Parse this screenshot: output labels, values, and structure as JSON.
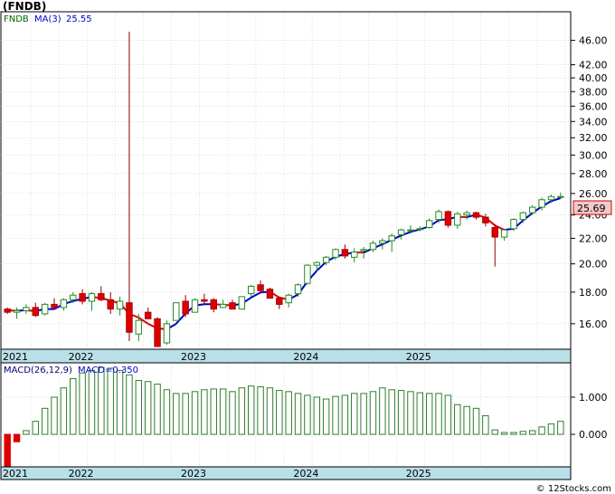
{
  "title": "(FNDB)",
  "footer": "© 12Stocks.com",
  "chart_data": [
    {
      "type": "candlestick",
      "name": "price",
      "legend": {
        "symbol": "FNDB",
        "ma_label": "MA(3)",
        "ma_value": "25.55"
      },
      "last_price_label": "25.69",
      "y_scale": "log",
      "ylim": [
        14.6,
        51
      ],
      "y_ticks": [
        "16.00",
        "18.00",
        "20.00",
        "22.00",
        "24.00",
        "26.00",
        "28.00",
        "30.00",
        "32.00",
        "34.00",
        "36.00",
        "38.00",
        "40.00",
        "42.00",
        "46.00"
      ],
      "x_labels": [
        "2021",
        "2022",
        "2023",
        "2024",
        "2025"
      ],
      "candles": [
        [
          16.9,
          17.0,
          16.6,
          16.7
        ],
        [
          16.7,
          17.0,
          16.3,
          16.8
        ],
        [
          16.8,
          17.2,
          16.6,
          17.0
        ],
        [
          17.0,
          17.3,
          16.4,
          16.5
        ],
        [
          16.6,
          17.3,
          16.5,
          17.2
        ],
        [
          17.2,
          17.6,
          16.9,
          17.0
        ],
        [
          17.0,
          17.6,
          16.8,
          17.5
        ],
        [
          17.5,
          18.0,
          17.3,
          17.8
        ],
        [
          17.9,
          18.2,
          17.2,
          17.4
        ],
        [
          17.4,
          18.0,
          16.8,
          17.9
        ],
        [
          17.9,
          18.4,
          17.4,
          17.5
        ],
        [
          17.5,
          18.0,
          16.6,
          16.9
        ],
        [
          16.9,
          17.7,
          16.5,
          17.4
        ],
        [
          17.3,
          47.5,
          15.0,
          15.5
        ],
        [
          15.4,
          16.6,
          15.0,
          16.2
        ],
        [
          16.7,
          17.0,
          16.3,
          16.3
        ],
        [
          16.3,
          16.4,
          14.7,
          14.7
        ],
        [
          14.9,
          16.2,
          14.8,
          16.0
        ],
        [
          16.2,
          17.3,
          16.2,
          17.3
        ],
        [
          17.4,
          17.8,
          16.4,
          16.6
        ],
        [
          16.7,
          17.6,
          16.7,
          17.5
        ],
        [
          17.5,
          17.9,
          17.2,
          17.4
        ],
        [
          17.5,
          17.6,
          16.7,
          16.9
        ],
        [
          17.0,
          17.5,
          17.0,
          17.2
        ],
        [
          17.3,
          17.5,
          16.9,
          16.9
        ],
        [
          16.9,
          17.7,
          16.9,
          17.7
        ],
        [
          17.9,
          18.5,
          17.7,
          18.4
        ],
        [
          18.5,
          18.8,
          17.9,
          18.1
        ],
        [
          18.2,
          18.3,
          17.6,
          17.6
        ],
        [
          17.6,
          17.7,
          16.9,
          17.2
        ],
        [
          17.3,
          17.9,
          17.0,
          17.8
        ],
        [
          17.9,
          18.6,
          17.7,
          18.5
        ],
        [
          18.6,
          20.0,
          18.5,
          19.9
        ],
        [
          19.9,
          20.2,
          19.4,
          20.1
        ],
        [
          20.1,
          20.6,
          19.9,
          20.5
        ],
        [
          20.5,
          21.2,
          20.3,
          21.1
        ],
        [
          21.1,
          21.5,
          20.4,
          20.6
        ],
        [
          20.5,
          21.2,
          20.1,
          20.9
        ],
        [
          21.0,
          21.3,
          20.4,
          21.1
        ],
        [
          21.1,
          21.8,
          20.9,
          21.6
        ],
        [
          21.6,
          22.0,
          21.1,
          21.8
        ],
        [
          21.8,
          22.4,
          20.9,
          22.2
        ],
        [
          22.3,
          22.8,
          21.9,
          22.7
        ],
        [
          22.7,
          23.1,
          22.4,
          22.7
        ],
        [
          22.8,
          23.0,
          22.6,
          22.8
        ],
        [
          22.9,
          23.7,
          22.8,
          23.5
        ],
        [
          23.6,
          24.5,
          23.3,
          24.3
        ],
        [
          24.3,
          24.4,
          22.9,
          23.1
        ],
        [
          23.1,
          24.3,
          22.8,
          24.1
        ],
        [
          24.0,
          24.4,
          23.6,
          24.2
        ],
        [
          24.2,
          24.3,
          23.6,
          23.8
        ],
        [
          23.8,
          24.1,
          23.0,
          23.3
        ],
        [
          22.9,
          23.2,
          19.8,
          22.1
        ],
        [
          22.1,
          22.8,
          21.8,
          22.7
        ],
        [
          22.8,
          23.7,
          22.6,
          23.6
        ],
        [
          23.6,
          24.3,
          23.3,
          24.2
        ],
        [
          24.2,
          24.9,
          24.0,
          24.7
        ],
        [
          24.7,
          25.6,
          24.4,
          25.4
        ],
        [
          25.4,
          25.9,
          25.1,
          25.7
        ],
        [
          25.7,
          26.1,
          25.5,
          25.7
        ]
      ],
      "ma3": [
        16.82,
        16.79,
        16.83,
        16.77,
        16.9,
        16.9,
        17.22,
        17.41,
        17.56,
        17.68,
        17.62,
        17.44,
        17.26,
        16.61,
        16.37,
        16.0,
        15.73,
        15.67,
        16.0,
        16.63,
        17.13,
        17.21,
        17.21,
        17.17,
        17.13,
        17.24,
        17.64,
        17.98,
        18.03,
        17.64,
        17.51,
        17.84,
        18.73,
        19.5,
        20.16,
        20.55,
        20.73,
        20.87,
        20.86,
        21.2,
        21.51,
        21.88,
        22.23,
        22.53,
        22.74,
        23.0,
        23.53,
        23.63,
        23.83,
        23.8,
        24.03,
        23.76,
        23.08,
        22.7,
        22.8,
        23.52,
        24.17,
        24.77,
        25.27,
        25.55
      ]
    },
    {
      "type": "bar",
      "name": "macd",
      "legend": {
        "label": "MACD(26,12,9)",
        "value_label": "MACD=0.350"
      },
      "ylim": [
        -0.85,
        1.9
      ],
      "y_ticks": [
        "1.000",
        "0.000"
      ],
      "x_labels": [
        "2021",
        "2022",
        "2023",
        "2024",
        "2025"
      ],
      "values": [
        -0.85,
        -0.2,
        0.1,
        0.35,
        0.7,
        1.0,
        1.25,
        1.5,
        1.65,
        1.72,
        1.8,
        1.78,
        1.72,
        1.6,
        1.45,
        1.42,
        1.35,
        1.2,
        1.1,
        1.1,
        1.15,
        1.2,
        1.22,
        1.22,
        1.15,
        1.25,
        1.3,
        1.28,
        1.25,
        1.18,
        1.15,
        1.1,
        1.05,
        1.0,
        0.95,
        1.02,
        1.05,
        1.1,
        1.1,
        1.15,
        1.25,
        1.2,
        1.18,
        1.15,
        1.12,
        1.1,
        1.1,
        1.05,
        0.8,
        0.75,
        0.7,
        0.5,
        0.12,
        0.05,
        0.05,
        0.08,
        0.1,
        0.2,
        0.28,
        0.35
      ]
    }
  ],
  "colors": {
    "up_candle": "#228b22",
    "down_candle": "#dd0000",
    "ma_up": "#0000cc",
    "ma_down": "#dd0000",
    "macd_pos": "#2e7d2e",
    "macd_neg": "#dd0000",
    "price_label_bg": "#f2c8c8",
    "axis_band": "#b9dfe9",
    "grid": "#cccccc",
    "legend_text": "#000080"
  }
}
